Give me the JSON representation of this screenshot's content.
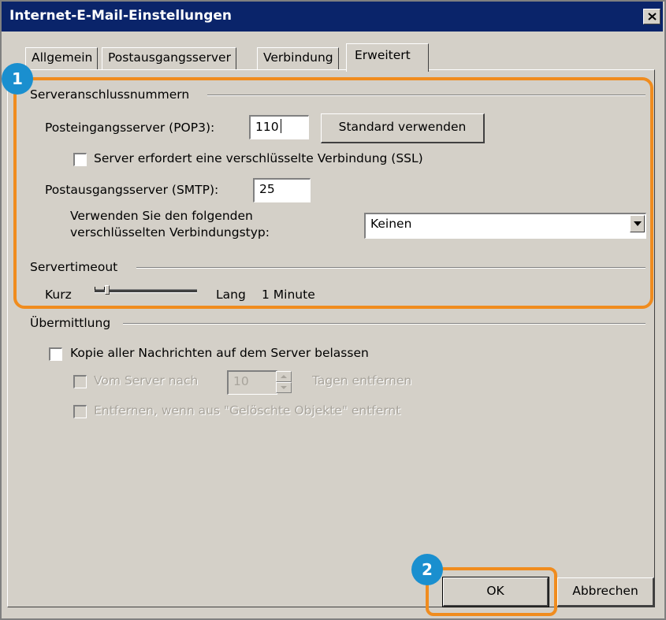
{
  "window": {
    "title": "Internet-E-Mail-Einstellungen"
  },
  "tabs": [
    {
      "label": "Allgemein",
      "active": false
    },
    {
      "label": "Postausgangsserver",
      "active": false
    },
    {
      "label": "Verbindung",
      "active": false
    },
    {
      "label": "Erweitert",
      "active": true
    }
  ],
  "server_ports": {
    "group_label": "Serveranschlussnummern",
    "pop3_label": "Posteingangsserver (POP3):",
    "pop3_value": "110",
    "default_button": "Standard verwenden",
    "ssl_label": "Server erfordert eine verschlüsselte Verbindung (SSL)",
    "ssl_checked": false,
    "smtp_label": "Postausgangsserver (SMTP):",
    "smtp_value": "25",
    "encryption_label_line1": "Verwenden Sie den folgenden",
    "encryption_label_line2": "verschlüsselten Verbindungstyp:",
    "encryption_value": "Keinen"
  },
  "timeout": {
    "group_label": "Servertimeout",
    "short_label": "Kurz",
    "long_label": "Lang",
    "value_text": "1 Minute",
    "level_fraction": 0.12
  },
  "delivery": {
    "group_label": "Übermittlung",
    "keep_copy_label": "Kopie aller Nachrichten auf dem Server belassen",
    "keep_copy_checked": false,
    "remove_after_label": "Vom Server nach",
    "remove_after_days": "10",
    "days_suffix": "Tagen entfernen",
    "remove_deleted_label": "Entfernen, wenn aus \"Gelöschte Objekte\" entfernt"
  },
  "buttons": {
    "ok": "OK",
    "cancel": "Abbrechen"
  },
  "annotations": {
    "badge1": "1",
    "badge2": "2",
    "highlight_color": "#f08c1e",
    "badge_color": "#1a8fcf"
  },
  "colors": {
    "titlebar": "#0a246a",
    "face": "#d4d0c8"
  }
}
